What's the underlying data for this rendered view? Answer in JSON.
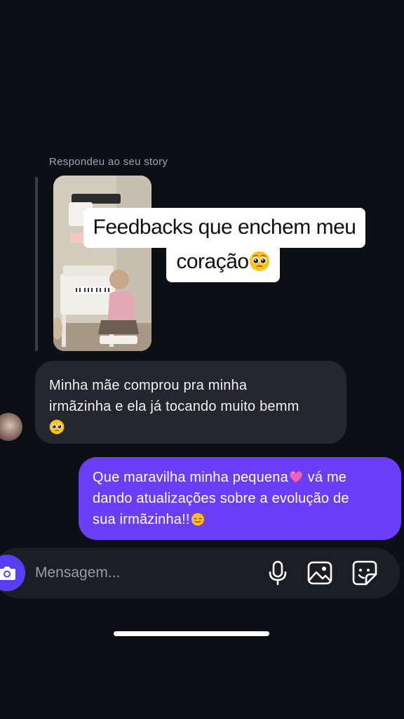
{
  "story": {
    "reply_label": "Respondeu ao seu story",
    "caption_line_1": "Feedbacks que enchem meu",
    "caption_line_2": "coração",
    "caption_emoji": "pleading-face-emoji"
  },
  "messages": [
    {
      "direction": "incoming",
      "lines": [
        "Minha mãe comprou pra minha",
        "irmãzinha e ela já tocando muito bemm"
      ],
      "trailing_emoji": "pleading-face-emoji"
    },
    {
      "direction": "outgoing",
      "line_1_text": "Que maravilha minha pequena",
      "line_1_emoji": "pink-heart-emoji",
      "line_1_rest": "vá me",
      "line_2": "dando atualizações sobre a evolução de",
      "line_3": "sua irmãzinha!!",
      "line_3_emoji": "smiling-face-with-hearts-emoji"
    }
  ],
  "composer": {
    "placeholder": "Mensagem...",
    "camera_icon": "camera-icon",
    "mic_icon": "microphone-icon",
    "gallery_icon": "image-icon",
    "sticker_icon": "sticker-icon"
  },
  "colors": {
    "background": "#0e0f14",
    "incoming_bubble": "#25272d",
    "outgoing_bubble": "#6a3ef6",
    "accent": "#5a3ff0"
  }
}
